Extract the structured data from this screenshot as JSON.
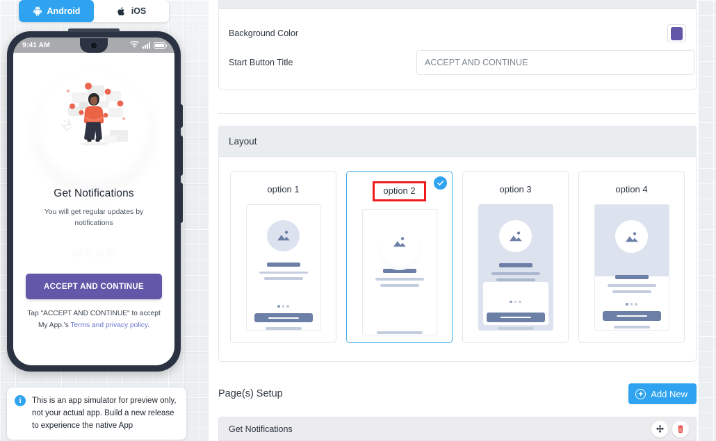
{
  "preview": {
    "platform_toggle": {
      "android_label": "Android",
      "android_icon": "android-icon",
      "ios_label": "iOS",
      "ios_icon": "apple-icon",
      "active": "Android",
      "active_color": "#2fa3ef"
    },
    "phone": {
      "status_time": "9:41 AM",
      "icons": [
        "wifi-icon",
        "signal-icon",
        "battery-icon"
      ],
      "title": "Get Notifications",
      "subtitle": "You will get regular updates by notifications",
      "dots_count": 4,
      "cta_label": "ACCEPT AND CONTINUE",
      "cta_color": "#6257a8",
      "note_prefix": "Tap \"ACCEPT AND CONTINUE\" to accept My App.'s ",
      "note_link": "Terms and privacy policy",
      "note_suffix": "."
    },
    "simulator_note": "This is an app simulator for preview only, not your actual app. Build a new release to experience the native App"
  },
  "form": {
    "top_section": {
      "header": "",
      "background_color_label": "Background Color",
      "background_color_value": "#6257a8",
      "start_button_title_label": "Start Button Title",
      "start_button_title_placeholder": "ACCEPT AND CONTINUE",
      "start_button_title_value": ""
    },
    "layout_section": {
      "header": "Layout",
      "selected_index": 1,
      "selected_highlight_color": "#ef1b1b",
      "selected_border_color": "#43aeea",
      "options": [
        {
          "label": "option 1",
          "style": "plain-circle-bottom-button"
        },
        {
          "label": "option 2",
          "style": "halo-no-button"
        },
        {
          "label": "option 3",
          "style": "full-fill-white-card"
        },
        {
          "label": "option 4",
          "style": "half-fill-bottom-button"
        }
      ]
    },
    "page_setup": {
      "title": "Page(s) Setup",
      "add_new_label": "Add New",
      "add_new_icon": "plus-circle-icon",
      "rows": [
        {
          "name": "Get Notifications",
          "move_icon": "move-arrows-icon",
          "delete_icon": "trash-icon",
          "delete_color": "#e53935"
        }
      ]
    }
  }
}
